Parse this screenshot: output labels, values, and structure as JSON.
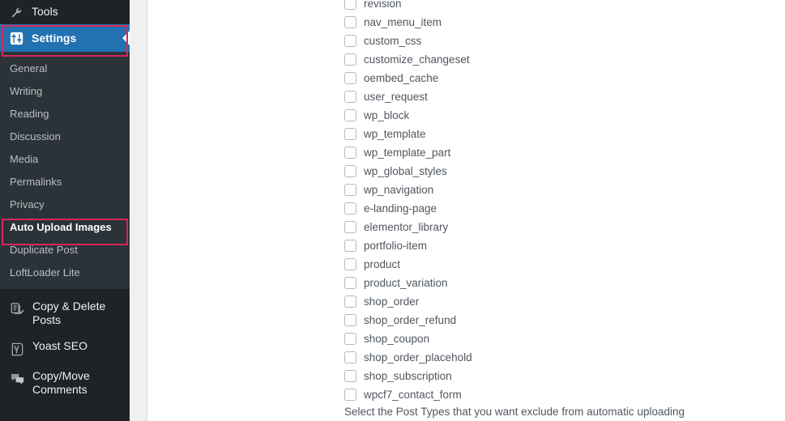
{
  "sidebar": {
    "top_item": {
      "label": "Tools",
      "icon": "wrench-icon"
    },
    "current_item": {
      "label": "Settings",
      "icon": "sliders-icon"
    },
    "submenu": [
      {
        "label": "General",
        "active": false
      },
      {
        "label": "Writing",
        "active": false
      },
      {
        "label": "Reading",
        "active": false
      },
      {
        "label": "Discussion",
        "active": false
      },
      {
        "label": "Media",
        "active": false
      },
      {
        "label": "Permalinks",
        "active": false
      },
      {
        "label": "Privacy",
        "active": false
      },
      {
        "label": "Auto Upload Images",
        "active": true
      },
      {
        "label": "Duplicate Post",
        "active": false
      },
      {
        "label": "LoftLoader Lite",
        "active": false
      }
    ],
    "bottom_items": [
      {
        "label": "Copy & Delete Posts",
        "icon": "copy-delete-posts-icon"
      },
      {
        "label": "Yoast SEO",
        "icon": "yoast-seo-icon"
      },
      {
        "label": "Copy/Move Comments",
        "icon": "comments-icon"
      }
    ]
  },
  "main": {
    "post_types": [
      {
        "label": "revision",
        "checked": false
      },
      {
        "label": "nav_menu_item",
        "checked": false
      },
      {
        "label": "custom_css",
        "checked": false
      },
      {
        "label": "customize_changeset",
        "checked": false
      },
      {
        "label": "oembed_cache",
        "checked": false
      },
      {
        "label": "user_request",
        "checked": false
      },
      {
        "label": "wp_block",
        "checked": false
      },
      {
        "label": "wp_template",
        "checked": false
      },
      {
        "label": "wp_template_part",
        "checked": false
      },
      {
        "label": "wp_global_styles",
        "checked": false
      },
      {
        "label": "wp_navigation",
        "checked": false
      },
      {
        "label": "e-landing-page",
        "checked": false
      },
      {
        "label": "elementor_library",
        "checked": false
      },
      {
        "label": "portfolio-item",
        "checked": false
      },
      {
        "label": "product",
        "checked": false
      },
      {
        "label": "product_variation",
        "checked": false
      },
      {
        "label": "shop_order",
        "checked": false
      },
      {
        "label": "shop_order_refund",
        "checked": false
      },
      {
        "label": "shop_coupon",
        "checked": false
      },
      {
        "label": "shop_order_placehold",
        "checked": false
      },
      {
        "label": "shop_subscription",
        "checked": false
      },
      {
        "label": "wpcf7_contact_form",
        "checked": false
      }
    ],
    "description": "Select the Post Types that you want exclude from automatic uploading"
  },
  "colors": {
    "sidebar_bg": "#1d2327",
    "submenu_bg": "#2c3338",
    "accent_blue": "#2271b1",
    "annotation": "#d6285a",
    "content_bg": "#ffffff"
  }
}
